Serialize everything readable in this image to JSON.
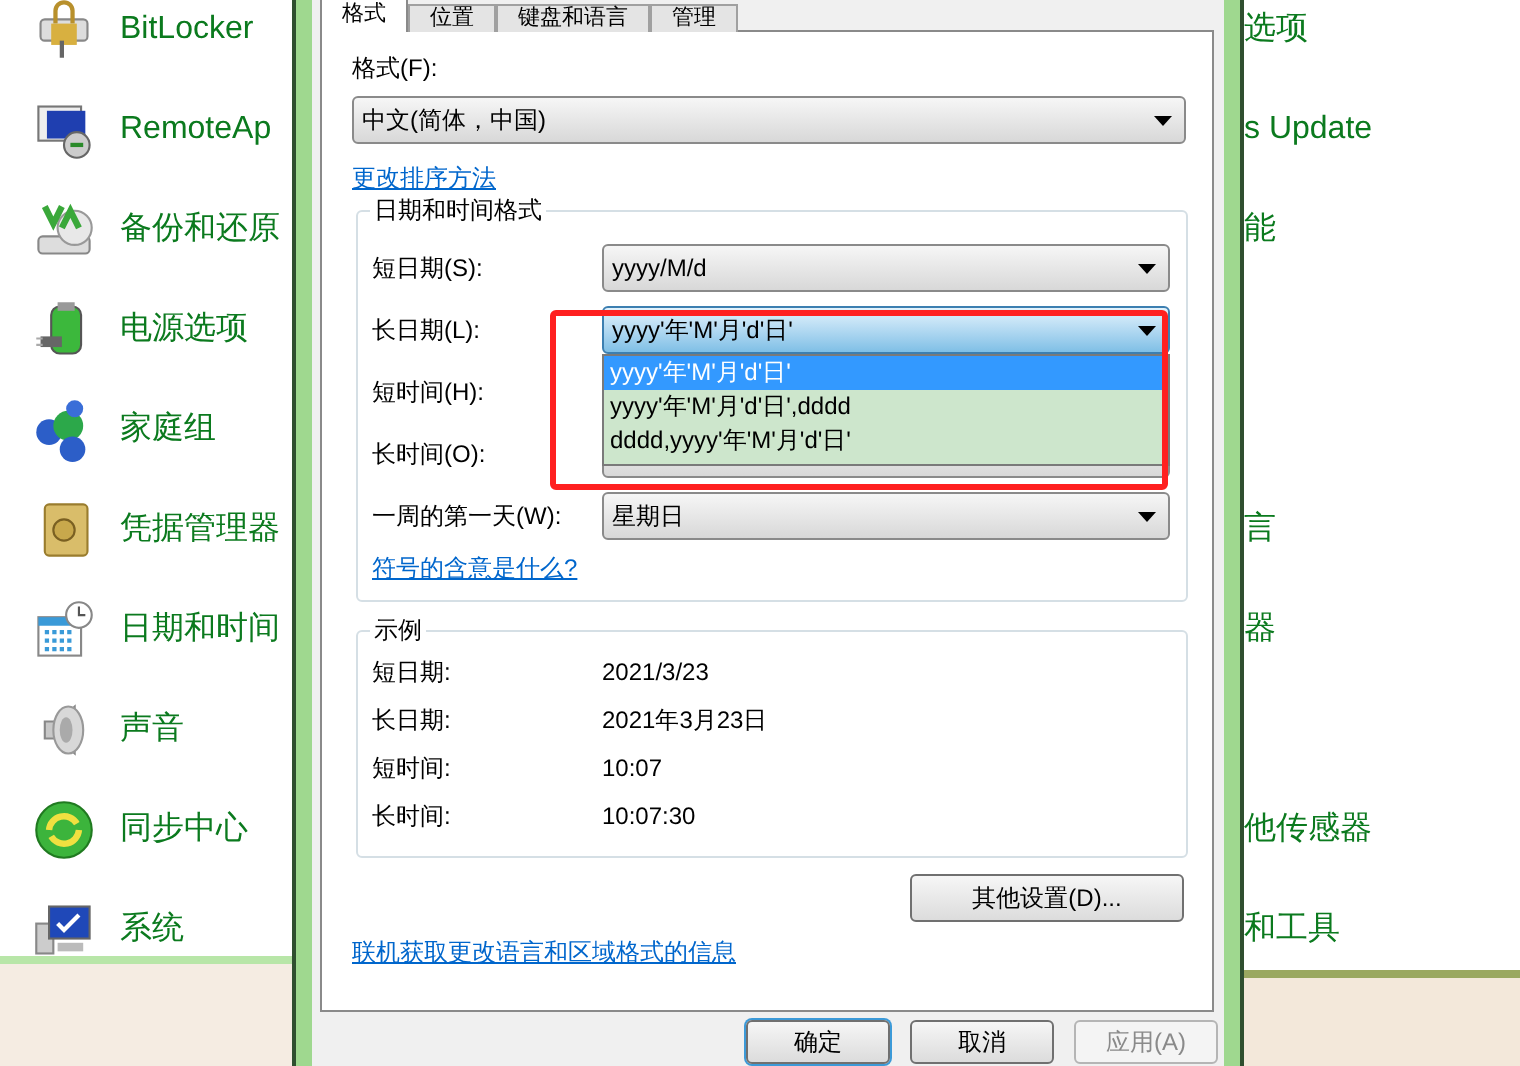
{
  "control_panel": {
    "items": [
      {
        "label": "BitLocker"
      },
      {
        "label": "RemoteAp"
      },
      {
        "label": "备份和还原"
      },
      {
        "label": "电源选项"
      },
      {
        "label": "家庭组"
      },
      {
        "label": "凭据管理器"
      },
      {
        "label": "日期和时间"
      },
      {
        "label": "声音"
      },
      {
        "label": "同步中心"
      },
      {
        "label": "系统"
      }
    ],
    "right_items": [
      {
        "label": "选项"
      },
      {
        "label": "s Update"
      },
      {
        "label": "能"
      },
      {
        "label": "言"
      },
      {
        "label": "器"
      },
      {
        "label": "他传感器"
      },
      {
        "label": "和工具"
      }
    ]
  },
  "dialog": {
    "tabs": [
      {
        "label": "格式",
        "selected": true
      },
      {
        "label": "位置",
        "selected": false
      },
      {
        "label": "键盘和语言",
        "selected": false
      },
      {
        "label": "管理",
        "selected": false
      }
    ],
    "format_label": "格式(F):",
    "format_value": "中文(简体，中国)",
    "sort_link": "更改排序方法",
    "formats_group": {
      "title": "日期和时间格式",
      "rows": [
        {
          "label": "短日期(S):",
          "value": "yyyy/M/d",
          "open": false
        },
        {
          "label": "长日期(L):",
          "value": "yyyy'年'M'月'd'日'",
          "open": true,
          "options": [
            {
              "text": "yyyy'年'M'月'd'日'",
              "selected": true
            },
            {
              "text": "yyyy'年'M'月'd'日',dddd",
              "selected": false
            },
            {
              "text": "dddd,yyyy'年'M'月'd'日'",
              "selected": false
            }
          ]
        },
        {
          "label": "短时间(H):",
          "open": false
        },
        {
          "label": "长时间(O):",
          "open": false
        },
        {
          "label": "一周的第一天(W):",
          "value": "星期日",
          "open": false
        }
      ],
      "link": "符号的含意是什么?"
    },
    "example_group": {
      "title": "示例",
      "rows": [
        {
          "label": "短日期:",
          "value": "2021/3/23"
        },
        {
          "label": "长日期:",
          "value": "2021年3月23日"
        },
        {
          "label": "短时间:",
          "value": "10:07"
        },
        {
          "label": "长时间:",
          "value": "10:07:30"
        }
      ]
    },
    "more_button": "其他设置(D)...",
    "online_link": "联机获取更改语言和区域格式的信息",
    "buttons": [
      {
        "label": "确定",
        "disabled": false
      },
      {
        "label": "取消",
        "disabled": false
      },
      {
        "label": "应用(A)",
        "disabled": true
      }
    ]
  }
}
